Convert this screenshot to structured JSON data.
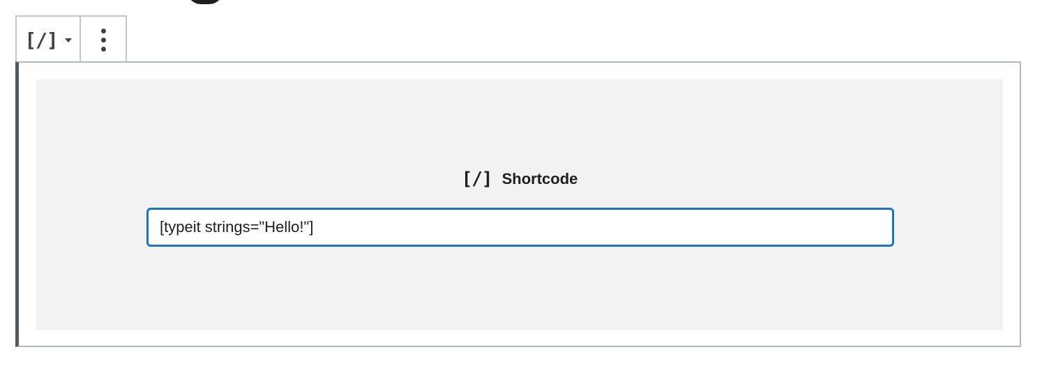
{
  "toolbar": {
    "switcher_icon": "[/]",
    "switcher_icon_name": "shortcode-icon",
    "more_icon_name": "kebab-menu-icon"
  },
  "block": {
    "label_icon": "[/]",
    "label": "Shortcode",
    "input_value": "[typeit strings=\"Hello!\"]",
    "input_placeholder": ""
  },
  "colors": {
    "input_focus_border": "#1e73be",
    "placeholder_bg": "#f2f2f2",
    "block_left_border": "#50575e"
  }
}
